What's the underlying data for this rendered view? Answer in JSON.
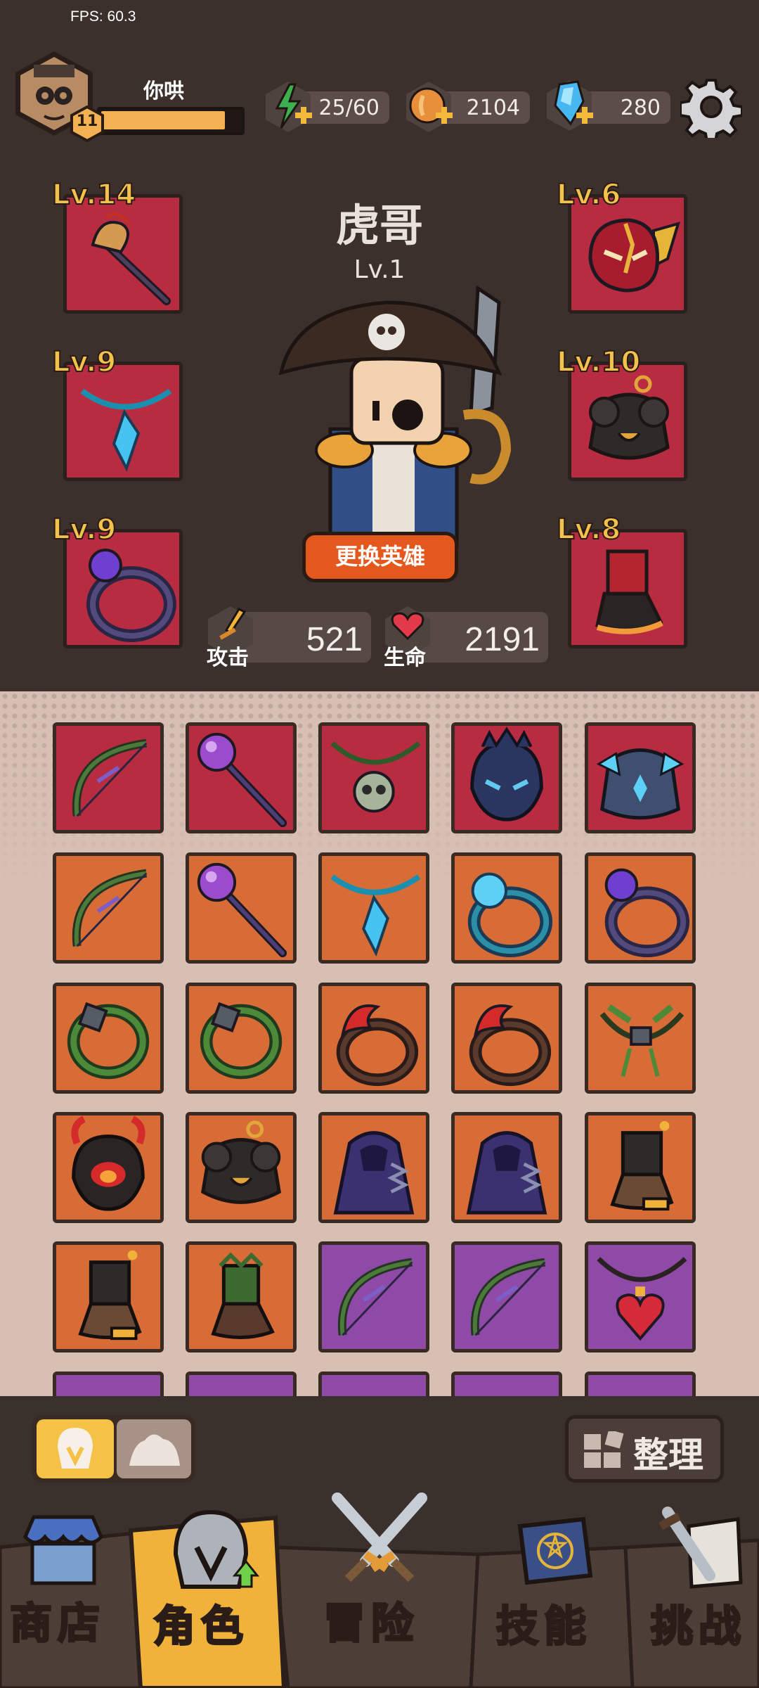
{
  "fps": "FPS: 60.3",
  "player": {
    "name": "你哄",
    "level": "11",
    "xp_progress": 0.9
  },
  "resources": [
    {
      "name": "energy",
      "icon": "lightning-icon",
      "value": "25/60"
    },
    {
      "name": "coins",
      "icon": "coin-icon",
      "value": "2104"
    },
    {
      "name": "gems",
      "icon": "gem-icon",
      "value": "280"
    }
  ],
  "hero": {
    "name": "虎哥",
    "level": "Lv.1",
    "change_label": "更换英雄"
  },
  "stats": {
    "attack": {
      "label": "攻击",
      "value": "521"
    },
    "hp": {
      "label": "生命",
      "value": "2191"
    }
  },
  "equipped": {
    "weapon": {
      "level": "Lv.14",
      "icon": "staff-weapon-icon"
    },
    "necklace": {
      "level": "Lv.9",
      "icon": "crystal-necklace-icon"
    },
    "ring": {
      "level": "Lv.9",
      "icon": "purple-ring-icon"
    },
    "helmet": {
      "level": "Lv.6",
      "icon": "winged-helmet-icon"
    },
    "armor": {
      "level": "Lv.10",
      "icon": "armor-icon"
    },
    "boots": {
      "level": "Lv.8",
      "icon": "fire-boots-icon"
    }
  },
  "inventory": [
    {
      "rarity": "red",
      "icon": "bow-icon"
    },
    {
      "rarity": "red",
      "icon": "orb-staff-icon"
    },
    {
      "rarity": "red",
      "icon": "skull-necklace-icon"
    },
    {
      "rarity": "red",
      "icon": "dark-helmet-icon"
    },
    {
      "rarity": "red",
      "icon": "crystal-armor-icon"
    },
    {
      "rarity": "orange",
      "icon": "bow-icon"
    },
    {
      "rarity": "orange",
      "icon": "orb-staff-icon"
    },
    {
      "rarity": "orange",
      "icon": "crystal-necklace-icon"
    },
    {
      "rarity": "orange",
      "icon": "blue-ring-icon"
    },
    {
      "rarity": "orange",
      "icon": "purple-ring-icon"
    },
    {
      "rarity": "orange",
      "icon": "vine-ring-icon"
    },
    {
      "rarity": "orange",
      "icon": "vine-ring-icon"
    },
    {
      "rarity": "orange",
      "icon": "flame-ring-icon"
    },
    {
      "rarity": "orange",
      "icon": "flame-ring-icon"
    },
    {
      "rarity": "orange",
      "icon": "leaf-necklace-icon"
    },
    {
      "rarity": "orange",
      "icon": "demon-helmet-icon"
    },
    {
      "rarity": "orange",
      "icon": "armor-icon"
    },
    {
      "rarity": "orange",
      "icon": "hood-cloak-icon"
    },
    {
      "rarity": "orange",
      "icon": "hood-cloak-icon"
    },
    {
      "rarity": "orange",
      "icon": "boots-icon"
    },
    {
      "rarity": "orange",
      "icon": "boots-icon"
    },
    {
      "rarity": "orange",
      "icon": "leaf-boots-icon"
    },
    {
      "rarity": "purple",
      "icon": "bow-icon"
    },
    {
      "rarity": "purple",
      "icon": "bow-icon"
    },
    {
      "rarity": "purple",
      "icon": "heart-necklace-icon"
    },
    {
      "rarity": "purple",
      "icon": "unknown"
    },
    {
      "rarity": "purple",
      "icon": "unknown"
    },
    {
      "rarity": "purple",
      "icon": "unknown"
    },
    {
      "rarity": "purple",
      "icon": "unknown"
    },
    {
      "rarity": "purple",
      "icon": "unknown"
    }
  ],
  "filter": {
    "tab1_icon": "helmet-filter-icon",
    "tab2_icon": "stone-filter-icon"
  },
  "sort_label": "整理",
  "nav": [
    {
      "label": "商店",
      "icon": "shop-icon"
    },
    {
      "label": "角色",
      "icon": "helmet-icon",
      "active": true
    },
    {
      "label": "冒险",
      "icon": "crossed-swords-icon"
    },
    {
      "label": "技能",
      "icon": "spellbook-icon"
    },
    {
      "label": "挑战",
      "icon": "sword-scroll-icon"
    }
  ],
  "colors": {
    "red": "#b72c40",
    "orange": "#d76c37",
    "purple": "#8e4aa6",
    "gold": "#f3c24c",
    "accent": "#e4581d"
  }
}
